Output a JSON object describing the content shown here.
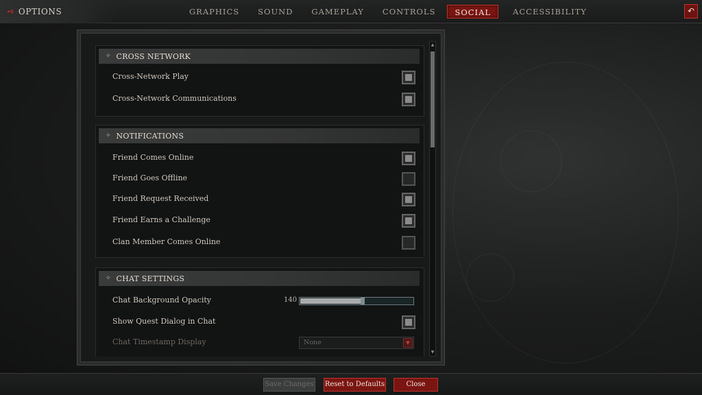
{
  "header": {
    "title": "OPTIONS",
    "tabs": [
      {
        "label": "GRAPHICS",
        "active": false
      },
      {
        "label": "SOUND",
        "active": false
      },
      {
        "label": "GAMEPLAY",
        "active": false
      },
      {
        "label": "CONTROLS",
        "active": false
      },
      {
        "label": "SOCIAL",
        "active": true
      },
      {
        "label": "ACCESSIBILITY",
        "active": false
      }
    ],
    "back_icon": "undo-arrow-icon"
  },
  "sections": {
    "cross_network": {
      "title": "CROSS NETWORK",
      "rows": [
        {
          "label": "Cross-Network Play",
          "checked": true
        },
        {
          "label": "Cross-Network Communications",
          "checked": true
        }
      ]
    },
    "notifications": {
      "title": "NOTIFICATIONS",
      "rows": [
        {
          "label": "Friend Comes Online",
          "checked": true
        },
        {
          "label": "Friend Goes Offline",
          "checked": false
        },
        {
          "label": "Friend Request Received",
          "checked": true
        },
        {
          "label": "Friend Earns a Challenge",
          "checked": true
        },
        {
          "label": "Clan Member Comes Online",
          "checked": false
        }
      ]
    },
    "chat_settings": {
      "title": "CHAT SETTINGS",
      "opacity": {
        "label": "Chat Background Opacity",
        "value": "140",
        "fraction": 0.53
      },
      "quest_dialog": {
        "label": "Show Quest Dialog in Chat",
        "checked": true
      },
      "timestamp": {
        "label": "Chat Timestamp Display",
        "value": "None"
      }
    }
  },
  "footer": {
    "save": "Save Changes",
    "reset": "Reset to Defaults",
    "close": "Close"
  },
  "colors": {
    "accent_red": "#7a1512",
    "accent_border": "#c2312a"
  }
}
